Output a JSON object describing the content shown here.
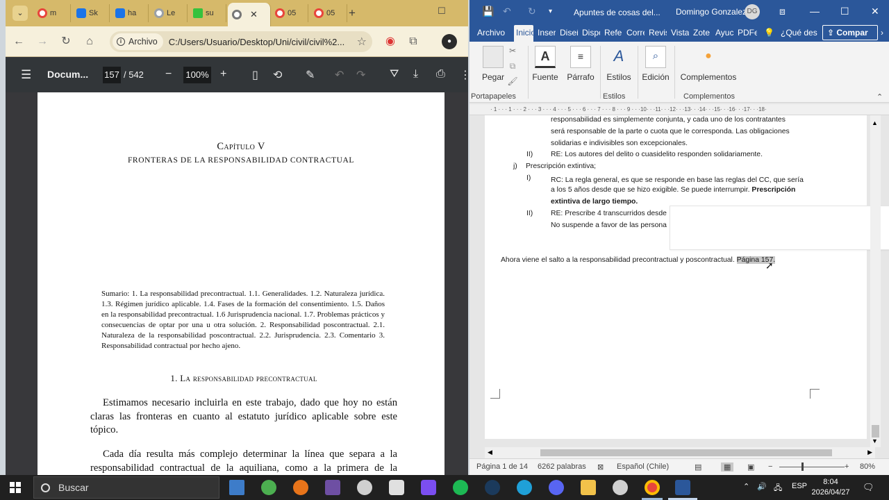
{
  "chrome": {
    "tabs": [
      {
        "label": "m",
        "color": "#e8453c"
      },
      {
        "label": "Sk",
        "color": "#1a73e8"
      },
      {
        "label": "ha",
        "color": "#1a73e8"
      },
      {
        "label": "Le",
        "color": "#9aa0a6"
      },
      {
        "label": "su",
        "color": "#36c23d"
      },
      {
        "label": "",
        "color": "#9aa0a6",
        "active": true
      },
      {
        "label": "05",
        "color": "#e8453c"
      },
      {
        "label": "05",
        "color": "#e8453c"
      }
    ],
    "address": {
      "chip": "Archivo",
      "url": "C:/Users/Usuario/Desktop/Uni/civil/civil%2..."
    },
    "pdf": {
      "title": "Docum...",
      "page": "157",
      "total": "/ 542",
      "zoom": "100%",
      "chapter": "Capítulo V",
      "chapter_sub": "FRONTERAS DE LA RESPONSABILIDAD CONTRACTUAL",
      "sumario": "Sumario: 1. La responsabilidad precontractual. 1.1. Generalidades. 1.2. Naturaleza jurídica. 1.3. Régimen jurídico aplicable. 1.4. Fases de la formación del consentimiento. 1.5. Daños en la responsabilidad precontractual. 1.6 Jurisprudencia nacional. 1.7. Problemas prácticos y consecuencias de optar por una u otra solución. 2. Responsabilidad poscontractual. 2.1. Naturaleza de la responsabilidad poscontractual. 2.2. Jurisprudencia. 2.3. Comentario 3. Responsabilidad contractual por hecho ajeno.",
      "section_heading": "1. La responsabilidad precontractual",
      "paragraph1": "Estimamos necesario incluirla en este trabajo, dado que hoy no están claras las fronteras en cuanto al estatuto jurídico aplicable sobre este tópico.",
      "paragraph2": "Cada día resulta más complejo determinar la línea que separa a la responsabilidad contractual de la aquiliana, como a la primera de la responsabilidad"
    }
  },
  "word": {
    "doc_title": "Apuntes de cosas del...",
    "user": "Domingo Gonzalez",
    "initials": "DG",
    "tabs": [
      "Archivo",
      "Inicio",
      "Inser",
      "Diseñ",
      "Dispo",
      "Refer",
      "Corre",
      "Revis",
      "Vista",
      "Zote",
      "Ayuc",
      "PDFe"
    ],
    "search_hint": "¿Qué des",
    "share": "Compar",
    "ribbon": {
      "pegar": "Pegar",
      "portapapeles": "Portapapeles",
      "fuente": "Fuente",
      "parrafo": "Párrafo",
      "estilos": "Estilos",
      "estilos_group": "Estilos",
      "edicion": "Edición",
      "complementos": "Complementos",
      "complementos_group": "Complementos"
    },
    "ruler": "· 1 · · · 1 · · · 2 · · · 3 · · · 4 · · · 5 · · · 6 · · · 7 · · · 8 · · · 9 · · ·10· · ·11· · ·12· · ·13· · ·14· · ·15· · ·16· · ·17· · ·18·",
    "doc": {
      "line_top": "responsabilidad es simplemente conjunta, y cada uno de los contratantes",
      "line_a": "será responsable de la parte o cuota que le corresponda. Las obligaciones",
      "line_b": "solidarias e indivisibles son excepcionales.",
      "ii_marker": "II)",
      "ii_text": "RE: Los autores del delito o cuasidelito responden solidariamente.",
      "j_marker": "j)",
      "j_text": "Prescripción extintiva;",
      "i_marker": "I)",
      "i_text_1": "RC: La regla general, es que se responde en base las reglas del CC, que sería",
      "i_text_2a": "a los 5 años desde que se hizo exigible. Se puede interrumpir.",
      "i_text_2b": "Prescripción",
      "i_text_3": "extintiva de largo tiempo.",
      "ii2_marker": "II)",
      "ii2_text_1": "RE: Prescribe 4 transcurridos desde",
      "ii2_text_2": "No suspende a favor de las persona",
      "closing": "Ahora viene el salto a la responsabilidad precontractual y poscontractual.",
      "closing_highlight": "Página 157."
    },
    "status": {
      "page": "Página 1 de 14",
      "words": "6262 palabras",
      "lang": "Español (Chile)",
      "zoom": "80%"
    }
  },
  "taskbar": {
    "search_placeholder": "Buscar",
    "lang": "ESP",
    "time": "8:04",
    "date": "2026/04/27"
  }
}
